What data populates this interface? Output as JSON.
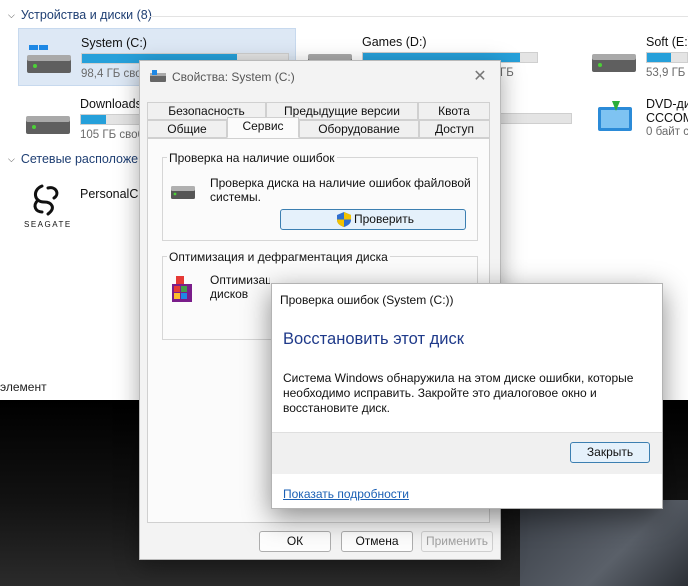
{
  "explorer": {
    "devices_header": "Устройства и диски (8)",
    "drives": [
      {
        "name": "System (C:)",
        "free": "98,4 ГБ своб",
        "usage": 0.75
      },
      {
        "name": "Games (D:)",
        "free": "ГБ",
        "usage": 0.9
      },
      {
        "name": "Soft (E:)",
        "free": "53,9 ГБ",
        "usage": 0.6
      },
      {
        "name": "Downloads",
        "free": "105 ГБ своб",
        "usage": 0.12
      },
      {
        "name": "DVD-дис",
        "label": "CCCOM",
        "free": "0 байт с"
      }
    ],
    "network_header": "Сетевые расположен",
    "network_item": {
      "name": "PersonalCl",
      "logo_text": "SEAGATE"
    },
    "status_text": "элемент"
  },
  "properties": {
    "title": "Свойства: System (C:)",
    "tabs_row1": [
      "Безопасность",
      "Предыдущие версии",
      "Квота"
    ],
    "tabs_row2": [
      "Общие",
      "Сервис",
      "Оборудование",
      "Доступ"
    ],
    "check_group": {
      "title": "Проверка на наличие ошибок",
      "description": "Проверка диска на наличие ошибок файловой системы.",
      "button": "Проверить"
    },
    "optimize_group": {
      "title": "Оптимизация и дефрагментация диска",
      "description": "Оптимизация дисков компьютера повышает эффективно"
    },
    "buttons": {
      "ok": "ОК",
      "cancel": "Отмена",
      "apply": "Применить"
    }
  },
  "popup": {
    "title": "Проверка ошибок (System (C:))",
    "heading": "Восстановить этот диск",
    "message": "Система Windows обнаружила на этом диске ошибки, которые необходимо исправить. Закройте это диалоговое окно и восстановите диск.",
    "close_button": "Закрыть",
    "details_link": "Показать подробности"
  },
  "colors": {
    "accent": "#26a0da",
    "heading": "#1f3a8a",
    "link": "#1a5fb4"
  }
}
